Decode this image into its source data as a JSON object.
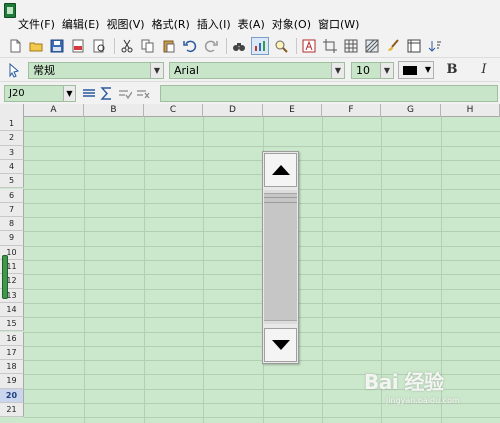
{
  "menubar": {
    "items": [
      "文件(F)",
      "编辑(E)",
      "视图(V)",
      "格式(R)",
      "插入(I)",
      "表(A)",
      "对象(O)",
      "窗口(W)"
    ]
  },
  "toolbar": {
    "icons": [
      "new-document-icon",
      "open-folder-icon",
      "save-icon",
      "export-pdf-icon",
      "print-preview-icon",
      "cut-icon",
      "copy-icon",
      "paste-icon",
      "undo-icon",
      "redo-icon",
      "binoculars-icon",
      "chart-icon",
      "zoom-icon",
      "text-icon",
      "crop-icon",
      "grid-icon",
      "pattern-icon",
      "brush-icon",
      "table-frame-icon",
      "sort-icon"
    ]
  },
  "format_bar": {
    "style_value": "常规",
    "font_value": "Arial",
    "size_value": "10",
    "font_color": "#000000",
    "bold_label": "B",
    "italic_label": "I"
  },
  "formula_bar": {
    "cell_ref": "J20",
    "formula_value": ""
  },
  "grid": {
    "columns": [
      "A",
      "B",
      "C",
      "D",
      "E",
      "F",
      "G",
      "H"
    ],
    "rows": [
      "1",
      "2",
      "3",
      "4",
      "5",
      "6",
      "7",
      "8",
      "9",
      "10",
      "11",
      "12",
      "13",
      "14",
      "15",
      "16",
      "17",
      "18",
      "19",
      "20",
      "21"
    ],
    "selected_row": "20",
    "cell_background": "#cce8cc"
  },
  "scrollbar": {
    "up_icon": "triangle-up-icon",
    "down_icon": "triangle-down-icon"
  },
  "watermark": {
    "main": "Bai 经验",
    "sub": "jingyan.baidu.com"
  }
}
